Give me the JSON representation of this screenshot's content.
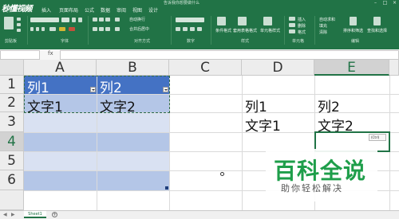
{
  "colors": {
    "ribbon": "#217346",
    "table_header": "#4472c4",
    "band_light": "#d9e1f2",
    "band_dark": "#b4c6e7",
    "watermark": "#1e9e4a"
  },
  "watermark_logo": "秒懂视频",
  "title_bar": {
    "search_hint": "告诉我你想要做什么"
  },
  "tabs": [
    "文件",
    "开始",
    "插入",
    "页面布局",
    "公式",
    "数据",
    "审阅",
    "视图",
    "设计"
  ],
  "ribbon": {
    "groups": [
      "剪贴板",
      "字体",
      "对齐方式",
      "数字",
      "样式",
      "单元格",
      "编辑"
    ],
    "buttons": {
      "wrap_text": "自动换行",
      "merge_center": "合并后居中",
      "conditional": "条件格式",
      "as_table": "套用表格格式",
      "cell_styles": "单元格样式",
      "insert": "插入",
      "delete": "删除",
      "format": "格式",
      "autosum": "自动求和",
      "fill": "填充",
      "clear": "清除",
      "sort_filter": "排序和筛选",
      "find_select": "查找和选择"
    }
  },
  "grid": {
    "columns": [
      "A",
      "B",
      "C",
      "D",
      "E"
    ],
    "rows": [
      "1",
      "2",
      "3",
      "4",
      "5",
      "6"
    ],
    "cells": {
      "A1": "列1",
      "B1": "列2",
      "A2": "文字1",
      "B2": "文字2",
      "D2": "列1",
      "E2": "列2",
      "D3": "文字1",
      "E3": "文字2"
    },
    "active_cell": "E4",
    "paste_options": "(Ctrl)"
  },
  "sheet_tabs": [
    "Sheet1"
  ],
  "watermark": {
    "main": "百科全说",
    "sub": "助你轻松解决"
  }
}
